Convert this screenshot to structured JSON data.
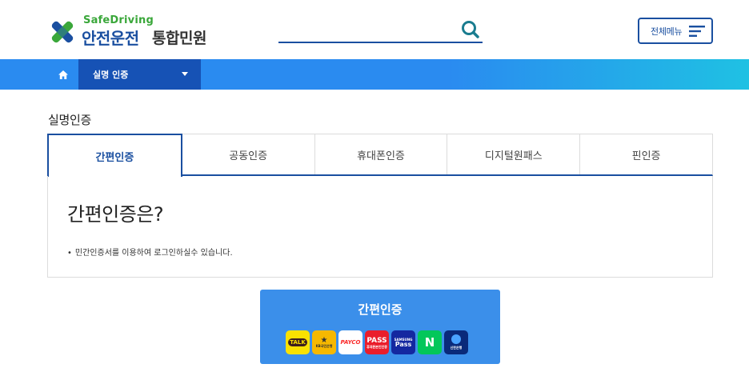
{
  "header": {
    "logo_en": "SafeDriving",
    "logo_ko_main": "안전운전",
    "logo_ko_sub": "통합민원",
    "search_value": "",
    "all_menu_label": "전체메뉴"
  },
  "nav": {
    "current_section": "실명 인증"
  },
  "page": {
    "title": "실명인증",
    "tabs": [
      {
        "label": "간편인증",
        "active": true
      },
      {
        "label": "공동인증",
        "active": false
      },
      {
        "label": "휴대폰인증",
        "active": false
      },
      {
        "label": "디지털원패스",
        "active": false
      },
      {
        "label": "핀인증",
        "active": false
      }
    ],
    "panel_heading": "간편인증은?",
    "panel_desc": "민간인증서를 이용하여 로그인하실수 있습니다.",
    "auth_button_label": "간편인증"
  },
  "providers": {
    "kakao": "TALK",
    "kb": "KB국민은행",
    "payco": "PAYCO",
    "pass": "PASS",
    "pass_sub": "휴대폰본인인증",
    "samsung": "Pass",
    "samsung_sub": "SAMSUNG",
    "naver": "N",
    "shinhan": "신한은행"
  },
  "colors": {
    "brand_blue": "#1a4fa0",
    "nav_blue": "#2a8bf0",
    "nav_dark": "#1652b5",
    "button_blue": "#3b8fea",
    "logo_green": "#3aa73a"
  }
}
